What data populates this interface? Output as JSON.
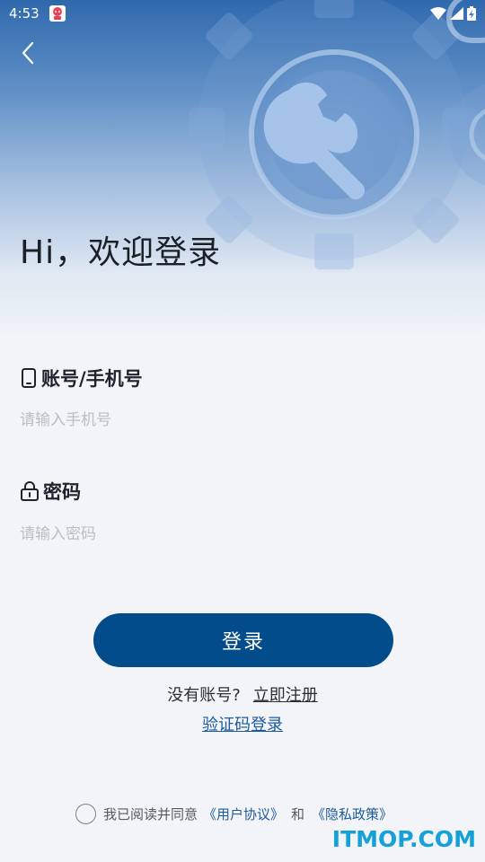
{
  "status_bar": {
    "time": "4:53",
    "icons": [
      "app-notification-icon",
      "wifi-icon",
      "signal-icon",
      "battery-charging-icon"
    ]
  },
  "header": {
    "back_icon": "chevron-left-icon",
    "greeting": "Hi，欢迎登录"
  },
  "form": {
    "account": {
      "icon": "phone-icon",
      "label": "账号/手机号",
      "placeholder": "请输入手机号",
      "value": ""
    },
    "password": {
      "icon": "lock-icon",
      "label": "密码",
      "placeholder": "请输入密码",
      "value": ""
    },
    "login_button": "登录"
  },
  "register": {
    "prompt": "没有账号?",
    "link": "立即注册"
  },
  "sms_login": "验证码登录",
  "agreement": {
    "checked": false,
    "prefix": "我已阅读并同意",
    "user_agreement": "《用户协议》",
    "and": "和",
    "privacy_policy": "《隐私政策》"
  },
  "watermark": "ITMOP.COM",
  "colors": {
    "primary": "#034c8c",
    "link": "#1b5a9e",
    "background": "#f2f4f8",
    "watermark": "#14a0d8"
  }
}
